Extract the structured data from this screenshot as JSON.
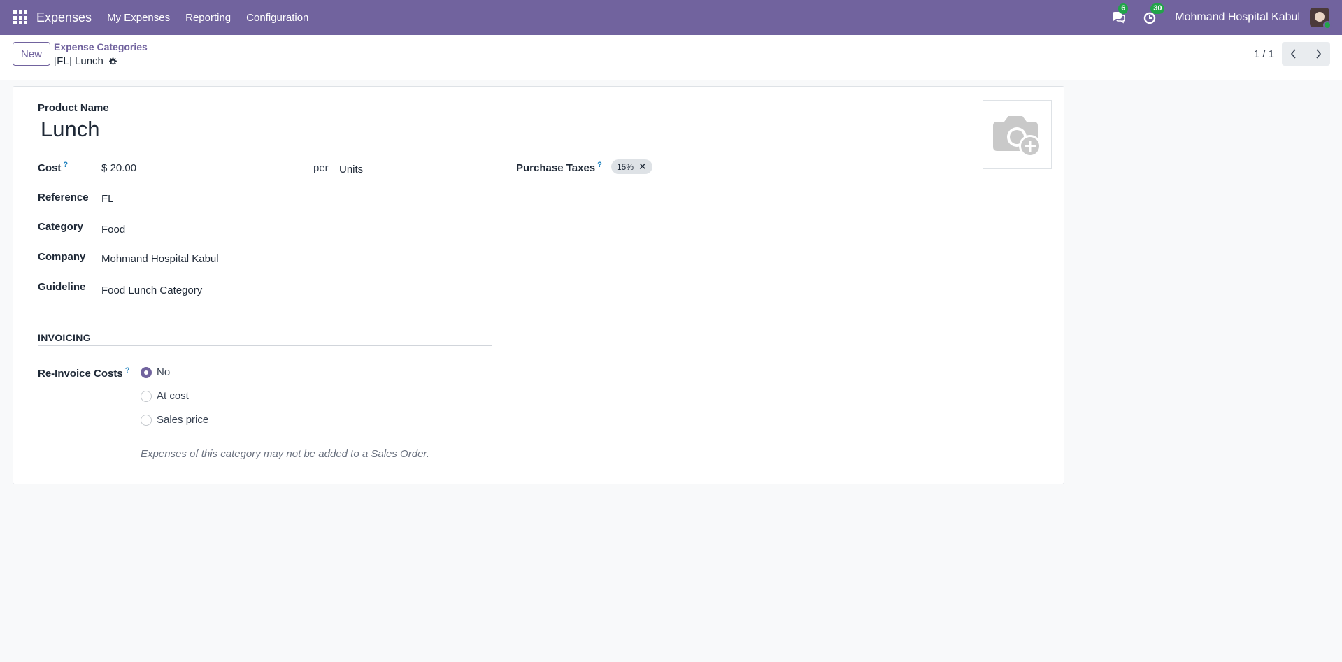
{
  "navbar": {
    "app_name": "Expenses",
    "menus": [
      "My Expenses",
      "Reporting",
      "Configuration"
    ],
    "messages_count": "6",
    "activities_count": "30",
    "company": "Mohmand Hospital Kabul",
    "color": "#71639e"
  },
  "control_panel": {
    "new_label": "New",
    "breadcrumb_parent": "Expense Categories",
    "breadcrumb_current": "[FL] Lunch",
    "pager": "1 / 1"
  },
  "form": {
    "product_name_label": "Product Name",
    "product_name": "Lunch",
    "cost_label": "Cost",
    "cost_help": "?",
    "cost_value": "$ 20.00",
    "per_label": "per",
    "uom": "Units",
    "reference_label": "Reference",
    "reference": "FL",
    "category_label": "Category",
    "category": "Food",
    "company_label": "Company",
    "company": "Mohmand Hospital Kabul",
    "guideline_label": "Guideline",
    "guideline": "Food Lunch Category",
    "purchase_taxes_label": "Purchase Taxes",
    "purchase_taxes_help": "?",
    "tax_tag": "15%",
    "tag_remove": "✕",
    "section_invoicing": "INVOICING",
    "reinvoice_label": "Re-Invoice Costs",
    "reinvoice_help": "?",
    "reinvoice_options": [
      "No",
      "At cost",
      "Sales price"
    ],
    "reinvoice_selected": "No",
    "note": "Expenses of this category may not be added to a Sales Order."
  }
}
